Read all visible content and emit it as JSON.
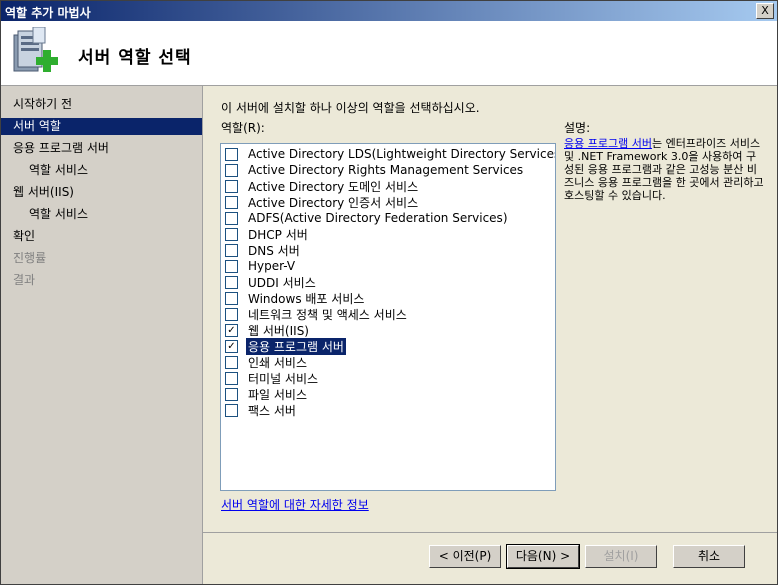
{
  "window": {
    "title": "역할 추가 마법사",
    "close_glyph": "X"
  },
  "header": {
    "title": "서버 역할 선택",
    "icon": "server-add-icon"
  },
  "sidebar": {
    "items": [
      {
        "label": "시작하기 전",
        "state": "normal"
      },
      {
        "label": "서버 역할",
        "state": "active"
      },
      {
        "label": "응용 프로그램 서버",
        "state": "normal"
      },
      {
        "label": "역할 서비스",
        "state": "sub"
      },
      {
        "label": "웹 서버(IIS)",
        "state": "normal"
      },
      {
        "label": "역할 서비스",
        "state": "sub"
      },
      {
        "label": "확인",
        "state": "normal"
      },
      {
        "label": "진행률",
        "state": "disabled"
      },
      {
        "label": "결과",
        "state": "disabled"
      }
    ]
  },
  "main": {
    "instruction": "이 서버에 설치할 하나 이상의 역할을 선택하십시오.",
    "roles_label": "역할(R):",
    "roles": [
      {
        "label": "Active Directory LDS(Lightweight Directory Services)",
        "checked": false
      },
      {
        "label": "Active Directory Rights Management Services",
        "checked": false
      },
      {
        "label": "Active Directory 도메인 서비스",
        "checked": false
      },
      {
        "label": "Active Directory 인증서 서비스",
        "checked": false
      },
      {
        "label": "ADFS(Active Directory Federation Services)",
        "checked": false
      },
      {
        "label": "DHCP 서버",
        "checked": false
      },
      {
        "label": "DNS 서버",
        "checked": false
      },
      {
        "label": "Hyper-V",
        "checked": false
      },
      {
        "label": "UDDI 서비스",
        "checked": false
      },
      {
        "label": "Windows 배포 서비스",
        "checked": false
      },
      {
        "label": "네트워크 정책 및 액세스 서비스",
        "checked": false
      },
      {
        "label": "웹 서버(IIS)",
        "checked": true
      },
      {
        "label": "응용 프로그램 서버",
        "checked": true
      },
      {
        "label": "인쇄 서비스",
        "checked": false
      },
      {
        "label": "터미널 서비스",
        "checked": false
      },
      {
        "label": "파일 서비스",
        "checked": false
      },
      {
        "label": "팩스 서버",
        "checked": false
      }
    ],
    "description": {
      "label": "설명:",
      "link_text": "응용 프로그램 서버",
      "text": "는 엔터프라이즈 서비스 및 .NET Framework 3.0을 사용하여 구성된 응용 프로그램과 같은 고성능 분산 비즈니스 응용 프로그램을 한 곳에서 관리하고 호스팅할 수 있습니다."
    },
    "more_info_link": "서버 역할에 대한 자세한 정보"
  },
  "buttons": {
    "back": "< 이전(P)",
    "next": "다음(N) >",
    "install": "설치(I)",
    "cancel": "취소"
  }
}
